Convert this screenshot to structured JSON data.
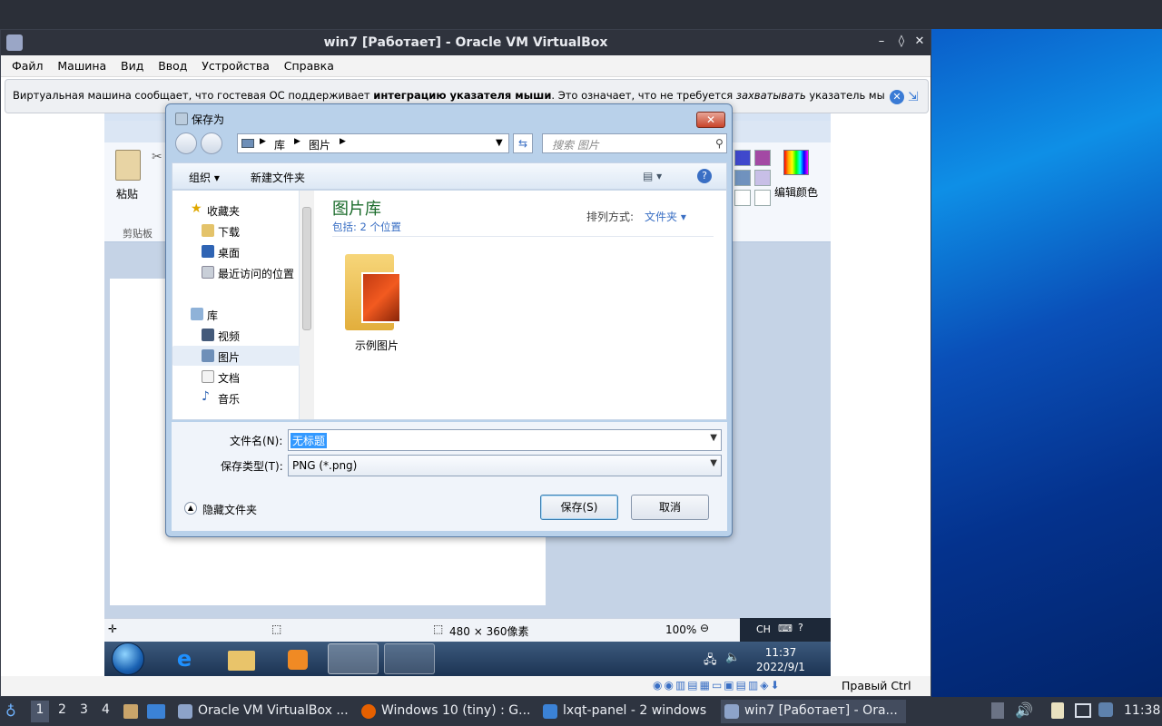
{
  "vbox": {
    "title": "win7 [Работает] - Oracle VM VirtualBox",
    "menu": [
      "Файл",
      "Машина",
      "Вид",
      "Ввод",
      "Устройства",
      "Справка"
    ],
    "notice_pre": "Виртуальная машина сообщает, что гостевая ОС поддерживает ",
    "notice_bold": "интеграцию указателя мыши",
    "notice_mid": ". Это означает, что не требуется ",
    "notice_italic": "захватывать",
    "notice_post": " указатель мыши",
    "host_key": "Правый Ctrl",
    "win_min": "–",
    "win_max": "◊",
    "win_close": "✕"
  },
  "paint": {
    "paste_label": "粘贴",
    "clipboard_label": "剪贴板",
    "edit_colors_label": "编辑颜色",
    "status_dimensions": "480 × 360像素",
    "zoom": "100%",
    "lang": "CH"
  },
  "win7_taskbar": {
    "time": "11:37",
    "date": "2022/9/1"
  },
  "dialog": {
    "title": "保存为",
    "address": [
      "库",
      "图片"
    ],
    "search_placeholder": "搜索 图片",
    "organize": "组织 ▾",
    "new_folder": "新建文件夹",
    "nav": [
      {
        "label": "收藏夹",
        "icon": "star-icon"
      },
      {
        "label": "下载",
        "icon": "download-folder-icon"
      },
      {
        "label": "桌面",
        "icon": "desktop-icon"
      },
      {
        "label": "最近访问的位置",
        "icon": "recent-places-icon"
      },
      {
        "label": "库",
        "icon": "library-icon"
      },
      {
        "label": "视频",
        "icon": "video-icon"
      },
      {
        "label": "图片",
        "icon": "pictures-icon"
      },
      {
        "label": "文档",
        "icon": "documents-icon"
      },
      {
        "label": "音乐",
        "icon": "music-icon"
      }
    ],
    "library_title": "图片库",
    "library_sub": "包括: 2 个位置",
    "arrange_label": "排列方式:",
    "arrange_value": "文件夹 ▾",
    "folder_name": "示例图片",
    "filename_label": "文件名(N):",
    "filename_value": "无标题",
    "filetype_label": "保存类型(T):",
    "filetype_value": "PNG (*.png)",
    "hide_folders": "隐藏文件夹",
    "save": "保存(S)",
    "cancel": "取消"
  },
  "panel": {
    "workspaces": [
      "1",
      "2",
      "3",
      "4"
    ],
    "tasks": [
      "Oracle VM VirtualBox ...",
      "Windows 10 (tiny) : G...",
      "lxqt-panel - 2 windows",
      "win7 [Работает] - Ora..."
    ],
    "time": "11:38"
  }
}
